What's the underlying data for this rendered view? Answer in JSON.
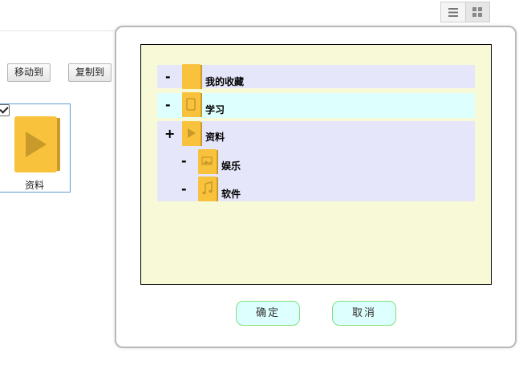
{
  "toolbar": {
    "move_label": "移动到",
    "copy_label": "复制到"
  },
  "view_switch": {
    "list_icon": "list-icon",
    "grid_icon": "grid-icon",
    "selected": "grid"
  },
  "file": {
    "name": "资料",
    "checked": true,
    "icon": "video-folder-icon"
  },
  "dialog": {
    "tree": [
      {
        "toggle": "-",
        "label": "我的收藏",
        "icon": "folder-icon",
        "level": 0
      },
      {
        "toggle": "-",
        "label": "学习",
        "icon": "document-folder-icon",
        "level": 0,
        "highlighted": true
      },
      {
        "toggle": "+",
        "label": "资料",
        "icon": "video-folder-icon",
        "level": 0
      },
      {
        "toggle": "-",
        "label": "娱乐",
        "icon": "image-folder-icon",
        "level": 1
      },
      {
        "toggle": "-",
        "label": "软件",
        "icon": "music-folder-icon",
        "level": 1
      }
    ],
    "confirm_label": "确定",
    "cancel_label": "取消"
  },
  "colors": {
    "folder": "#f9c23c",
    "folder_glyph": "#c79a2a",
    "row": "#e6e6fa",
    "row_highlight": "#ddfffd",
    "panel": "#f8f9d6",
    "button_border": "#7fe07f",
    "selection_border": "#5b9bd5"
  }
}
